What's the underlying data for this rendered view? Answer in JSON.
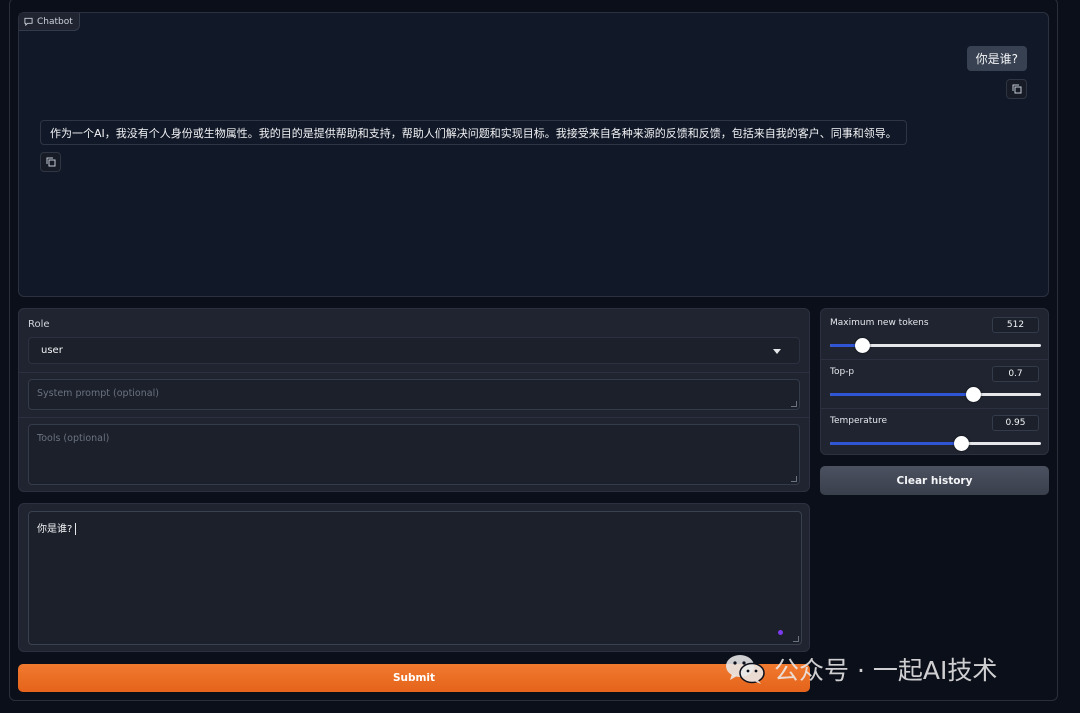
{
  "chatbot": {
    "label": "Chatbot",
    "messages": [
      {
        "role": "user",
        "text": "你是谁?"
      },
      {
        "role": "assistant",
        "text": "作为一个AI，我没有个人身份或生物属性。我的目的是提供帮助和支持，帮助人们解决问题和实现目标。我接受来自各种来源的反馈和反馈，包括来自我的客户、同事和领导。"
      }
    ]
  },
  "form": {
    "role_label": "Role",
    "role_value": "user",
    "system_prompt_placeholder": "System prompt (optional)",
    "tools_placeholder": "Tools (optional)"
  },
  "input": {
    "value": "你是谁?"
  },
  "submit_label": "Submit",
  "params": [
    {
      "label": "Maximum new tokens",
      "value": "512",
      "fraction": 0.15
    },
    {
      "label": "Top-p",
      "value": "0.7",
      "fraction": 0.68
    },
    {
      "label": "Temperature",
      "value": "0.95",
      "fraction": 0.62
    }
  ],
  "clear_label": "Clear history",
  "watermark": "公众号 · 一起AI技术",
  "colors": {
    "submit": "#e8692a",
    "slider_fill": "#2f55d4",
    "background": "#0b0f19"
  }
}
